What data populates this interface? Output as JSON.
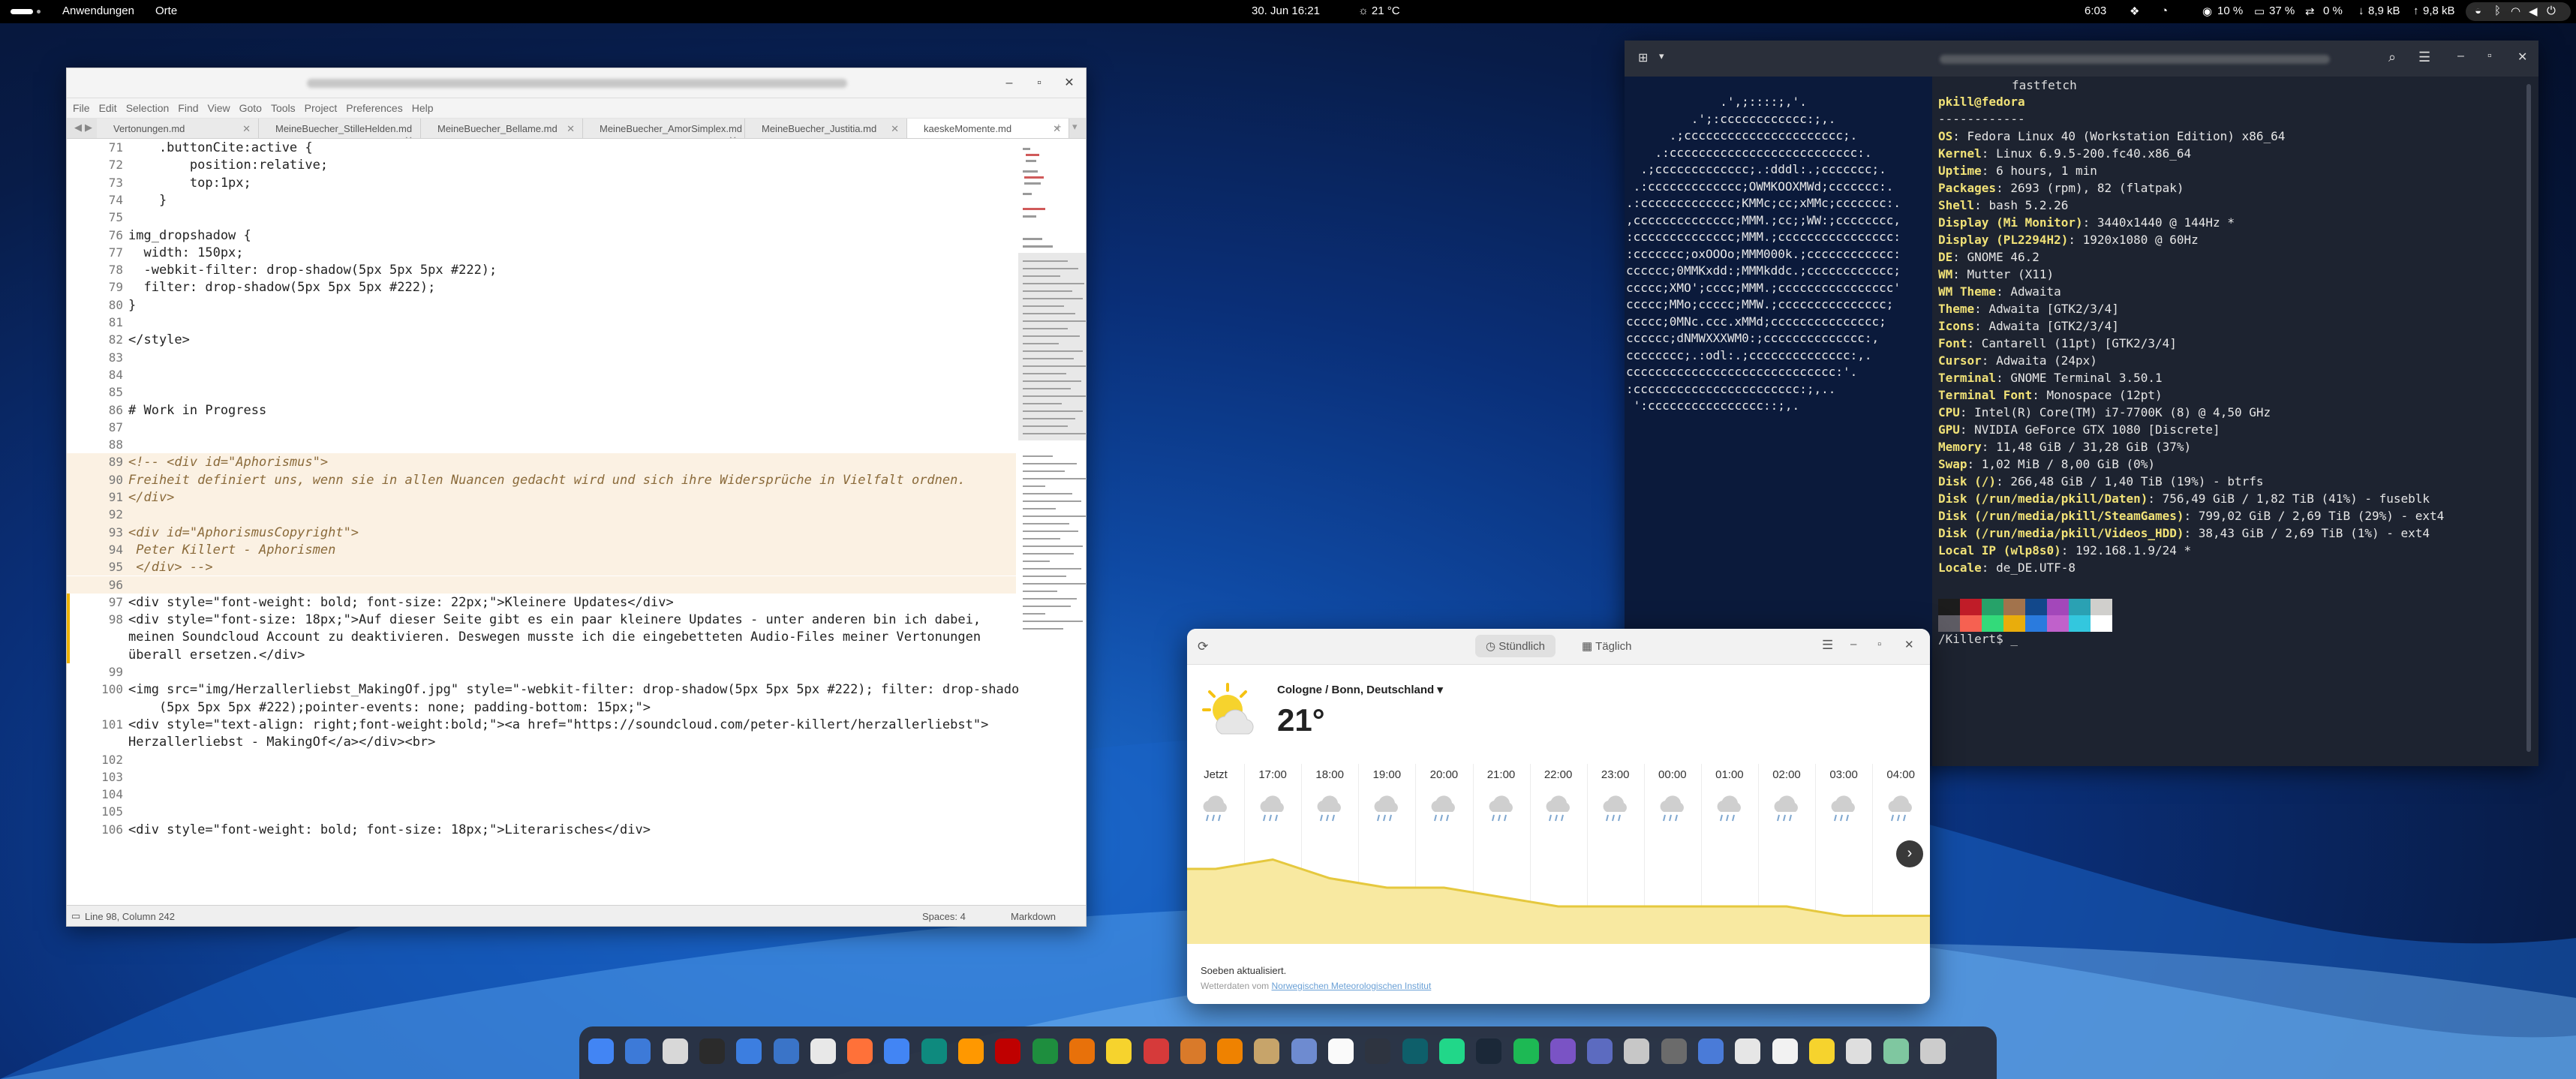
{
  "topbar": {
    "activities": "Anwendungen",
    "places": "Orte",
    "datetime": "30. Jun 16:21",
    "weather": "☼ 21 °C",
    "uptime": "6:03",
    "cpu": "10 %",
    "mem": "37 %",
    "swap": "0 %",
    "net_down": "8,9 kB",
    "net_up": "9,8 kB"
  },
  "editor": {
    "menu": [
      "File",
      "Edit",
      "Selection",
      "Find",
      "View",
      "Goto",
      "Tools",
      "Project",
      "Preferences",
      "Help"
    ],
    "tabs": [
      {
        "label": "Vertonungen.md"
      },
      {
        "label": "MeineBuecher_StilleHelden.md"
      },
      {
        "label": "MeineBuecher_Bellame.md"
      },
      {
        "label": "MeineBuecher_AmorSimplex.md"
      },
      {
        "label": "MeineBuecher_Justitia.md"
      },
      {
        "label": "kaeskeMomente.md",
        "active": true
      }
    ],
    "lines": [
      {
        "n": "71",
        "t": "    .buttonCite:active {"
      },
      {
        "n": "72",
        "t": "        position:relative;"
      },
      {
        "n": "73",
        "t": "        top:1px;"
      },
      {
        "n": "74",
        "t": "    }"
      },
      {
        "n": "75",
        "t": ""
      },
      {
        "n": "76",
        "t": "img_dropshadow {"
      },
      {
        "n": "77",
        "t": "  width: 150px;"
      },
      {
        "n": "78",
        "t": "  -webkit-filter: drop-shadow(5px 5px 5px #222);"
      },
      {
        "n": "79",
        "t": "  filter: drop-shadow(5px 5px 5px #222);"
      },
      {
        "n": "80",
        "t": "}"
      },
      {
        "n": "81",
        "t": ""
      },
      {
        "n": "82",
        "t": "</style>"
      },
      {
        "n": "83",
        "t": ""
      },
      {
        "n": "84",
        "t": ""
      },
      {
        "n": "85",
        "t": ""
      },
      {
        "n": "86",
        "t": "# Work in Progress"
      },
      {
        "n": "87",
        "t": ""
      },
      {
        "n": "88",
        "t": ""
      },
      {
        "n": "89",
        "t": "<!-- <div id=\"Aphorismus\">"
      },
      {
        "n": "90",
        "t": "Freiheit definiert uns, wenn sie in allen Nuancen gedacht wird und sich ihre Widersprüche in Vielfalt ordnen."
      },
      {
        "n": "91",
        "t": "</div>"
      },
      {
        "n": "92",
        "t": ""
      },
      {
        "n": "93",
        "t": "<div id=\"AphorismusCopyright\">"
      },
      {
        "n": "94",
        "t": " Peter Killert - Aphorismen"
      },
      {
        "n": "95",
        "t": " </div> -->"
      },
      {
        "n": "96",
        "t": ""
      },
      {
        "n": "97",
        "t": "<div style=\"font-weight: bold; font-size: 22px;\">Kleinere Updates</div>"
      },
      {
        "n": "98",
        "t": "<div style=\"font-size: 18px;\">Auf dieser Seite gibt es ein paar kleinere Updates - unter anderen bin ich dabei,"
      },
      {
        "n": "",
        "t": "meinen Soundcloud Account zu deaktivieren. Deswegen musste ich die eingebetteten Audio-Files meiner Vertonungen"
      },
      {
        "n": "",
        "t": "überall ersetzen.</div>"
      },
      {
        "n": "99",
        "t": ""
      },
      {
        "n": "100",
        "t": "<img src=\"img/Herzallerliebst_MakingOf.jpg\" style=\"-webkit-filter: drop-shadow(5px 5px 5px #222); filter: drop-shadow"
      },
      {
        "n": "",
        "t": "    (5px 5px 5px #222);pointer-events: none; padding-bottom: 15px;\">"
      },
      {
        "n": "101",
        "t": "<div style=\"text-align: right;font-weight:bold;\"><a href=\"https://soundcloud.com/peter-killert/herzallerliebst\">"
      },
      {
        "n": "",
        "t": "Herzallerliebst - MakingOf</a></div><br>"
      },
      {
        "n": "102",
        "t": ""
      },
      {
        "n": "103",
        "t": ""
      },
      {
        "n": "104",
        "t": ""
      },
      {
        "n": "105",
        "t": ""
      },
      {
        "n": "106",
        "t": "<div style=\"font-weight: bold; font-size: 18px;\">Literarisches</div>"
      }
    ],
    "status": {
      "position": "Line 98, Column 242",
      "spaces": "Spaces: 4",
      "syntax": "Markdown"
    }
  },
  "terminal": {
    "command": "fastfetch",
    "art": [
      "             .',;::::;,'.",
      "         .';:cccccccccccc:;,.",
      "      .;cccccccccccccccccccccc;.",
      "    .:cccccccccccccccccccccccccc:.",
      "  .;ccccccccccccc;.:dddl:.;ccccccc;.",
      " .:ccccccccccccc;OWMKOOXMWd;ccccccc:.",
      ".:ccccccccccccc;KMMc;cc;xMMc;ccccccc:.",
      ",cccccccccccccc;MMM.;cc;;WW:;cccccccc,",
      ":cccccccccccccc;MMM.;cccccccccccccccc:",
      ":ccccccc;oxOOOo;MMM000k.;cccccccccccc:",
      "cccccc;0MMKxdd:;MMMkddc.;cccccccccccc;",
      "ccccc;XMO';cccc;MMM.;cccccccccccccccc'",
      "ccccc;MMo;ccccc;MMW.;ccccccccccccccc;",
      "ccccc;0MNc.ccc.xMMd;ccccccccccccccc;",
      "cccccc;dNMWXXXWM0:;cccccccccccccc:,",
      "cccccccc;.:odl:.;cccccccccccccc:,.",
      "ccccccccccccccccccccccccccccc:'.",
      ":ccccccccccccccccccccccc:;,..",
      " ':cccccccccccccccc::;,."
    ],
    "user": "pkill@fedora",
    "separator": "------------",
    "info": [
      {
        "k": "OS",
        "v": "Fedora Linux 40 (Workstation Edition) x86_64"
      },
      {
        "k": "Kernel",
        "v": "Linux 6.9.5-200.fc40.x86_64"
      },
      {
        "k": "Uptime",
        "v": "6 hours, 1 min"
      },
      {
        "k": "Packages",
        "v": "2693 (rpm), 82 (flatpak)"
      },
      {
        "k": "Shell",
        "v": "bash 5.2.26"
      },
      {
        "k": "Display (Mi Monitor)",
        "v": "3440x1440 @ 144Hz *"
      },
      {
        "k": "Display (PL2294H2)",
        "v": "1920x1080 @ 60Hz"
      },
      {
        "k": "DE",
        "v": "GNOME 46.2"
      },
      {
        "k": "WM",
        "v": "Mutter (X11)"
      },
      {
        "k": "WM Theme",
        "v": "Adwaita"
      },
      {
        "k": "Theme",
        "v": "Adwaita [GTK2/3/4]"
      },
      {
        "k": "Icons",
        "v": "Adwaita [GTK2/3/4]"
      },
      {
        "k": "Font",
        "v": "Cantarell (11pt) [GTK2/3/4]"
      },
      {
        "k": "Cursor",
        "v": "Adwaita (24px)"
      },
      {
        "k": "Terminal",
        "v": "GNOME Terminal 3.50.1"
      },
      {
        "k": "Terminal Font",
        "v": "Monospace (12pt)"
      },
      {
        "k": "CPU",
        "v": "Intel(R) Core(TM) i7-7700K (8) @ 4,50 GHz"
      },
      {
        "k": "GPU",
        "v": "NVIDIA GeForce GTX 1080 [Discrete]"
      },
      {
        "k": "Memory",
        "v": "11,48 GiB / 31,28 GiB (37%)"
      },
      {
        "k": "Swap",
        "v": "1,02 MiB / 8,00 GiB (0%)"
      },
      {
        "k": "Disk (/)",
        "v": "266,48 GiB / 1,40 TiB (19%) - btrfs"
      },
      {
        "k": "Disk (/run/media/pkill/Daten)",
        "v": "756,49 GiB / 1,82 TiB (41%) - fuseblk"
      },
      {
        "k": "Disk (/run/media/pkill/SteamGames)",
        "v": "799,02 GiB / 2,69 TiB (29%) - ext4"
      },
      {
        "k": "Disk (/run/media/pkill/Videos_HDD)",
        "v": "38,43 GiB / 2,69 TiB (1%) - ext4"
      },
      {
        "k": "Local IP (wlp8s0)",
        "v": "192.168.1.9/24 *"
      },
      {
        "k": "Locale",
        "v": "de_DE.UTF-8"
      }
    ],
    "prompt": "/Killert$ _",
    "palette": [
      "#1c1c1c",
      "#c01c28",
      "#26a269",
      "#a2734c",
      "#12488b",
      "#a347ba",
      "#2aa1b3",
      "#d0cfcc",
      "#5e5c64",
      "#f66151",
      "#33da7a",
      "#e9ad0c",
      "#2a7bde",
      "#c061cb",
      "#33c7de",
      "#ffffff"
    ]
  },
  "weather": {
    "tab_hourly": "Stündlich",
    "tab_daily": "Täglich",
    "location": "Cologne / Bonn, Deutschland",
    "temp": "21°",
    "hours": [
      {
        "time": "Jetzt",
        "temp": "20°"
      },
      {
        "time": "17:00",
        "temp": "21°"
      },
      {
        "time": "18:00",
        "temp": "19°"
      },
      {
        "time": "19:00",
        "temp": "18°"
      },
      {
        "time": "20:00",
        "temp": "18°"
      },
      {
        "time": "21:00",
        "temp": "17°"
      },
      {
        "time": "22:00",
        "temp": "16°"
      },
      {
        "time": "23:00",
        "temp": "16°"
      },
      {
        "time": "00:00",
        "temp": "16°"
      },
      {
        "time": "01:00",
        "temp": "16°"
      },
      {
        "time": "02:00",
        "temp": "16°"
      },
      {
        "time": "03:00",
        "temp": "15°"
      },
      {
        "time": "04:00",
        "temp": "15°"
      }
    ],
    "updated": "Soeben aktualisiert.",
    "source_prefix": "Wetterdaten vom ",
    "source_link": "Norwegischen Meteorologischen Institut"
  },
  "dock": {
    "apps": [
      "chrome-icon",
      "mail-icon",
      "calendar-icon",
      "terminal-icon",
      "files-icon",
      "vscode-icon",
      "steam-like-icon",
      "firefox-icon",
      "chrome2-icon",
      "edge-icon",
      "sublime-icon",
      "filezilla-icon",
      "sheets-icon",
      "slides-icon",
      "notes-icon",
      "affinity-icon",
      "blender-icon",
      "vlc-icon",
      "image-icon",
      "paint-icon",
      "mapmaker-icon",
      "calculator-icon",
      "book-icon",
      "pycharm-icon",
      "steam-icon",
      "spotify-icon",
      "obsidian-icon",
      "store-icon",
      "pdf-icon",
      "settings-icon",
      "extensions-icon",
      "texteditor-icon",
      "document-icon",
      "weather-icon",
      "document2-icon",
      "trash-icon",
      "grid-icon"
    ]
  }
}
